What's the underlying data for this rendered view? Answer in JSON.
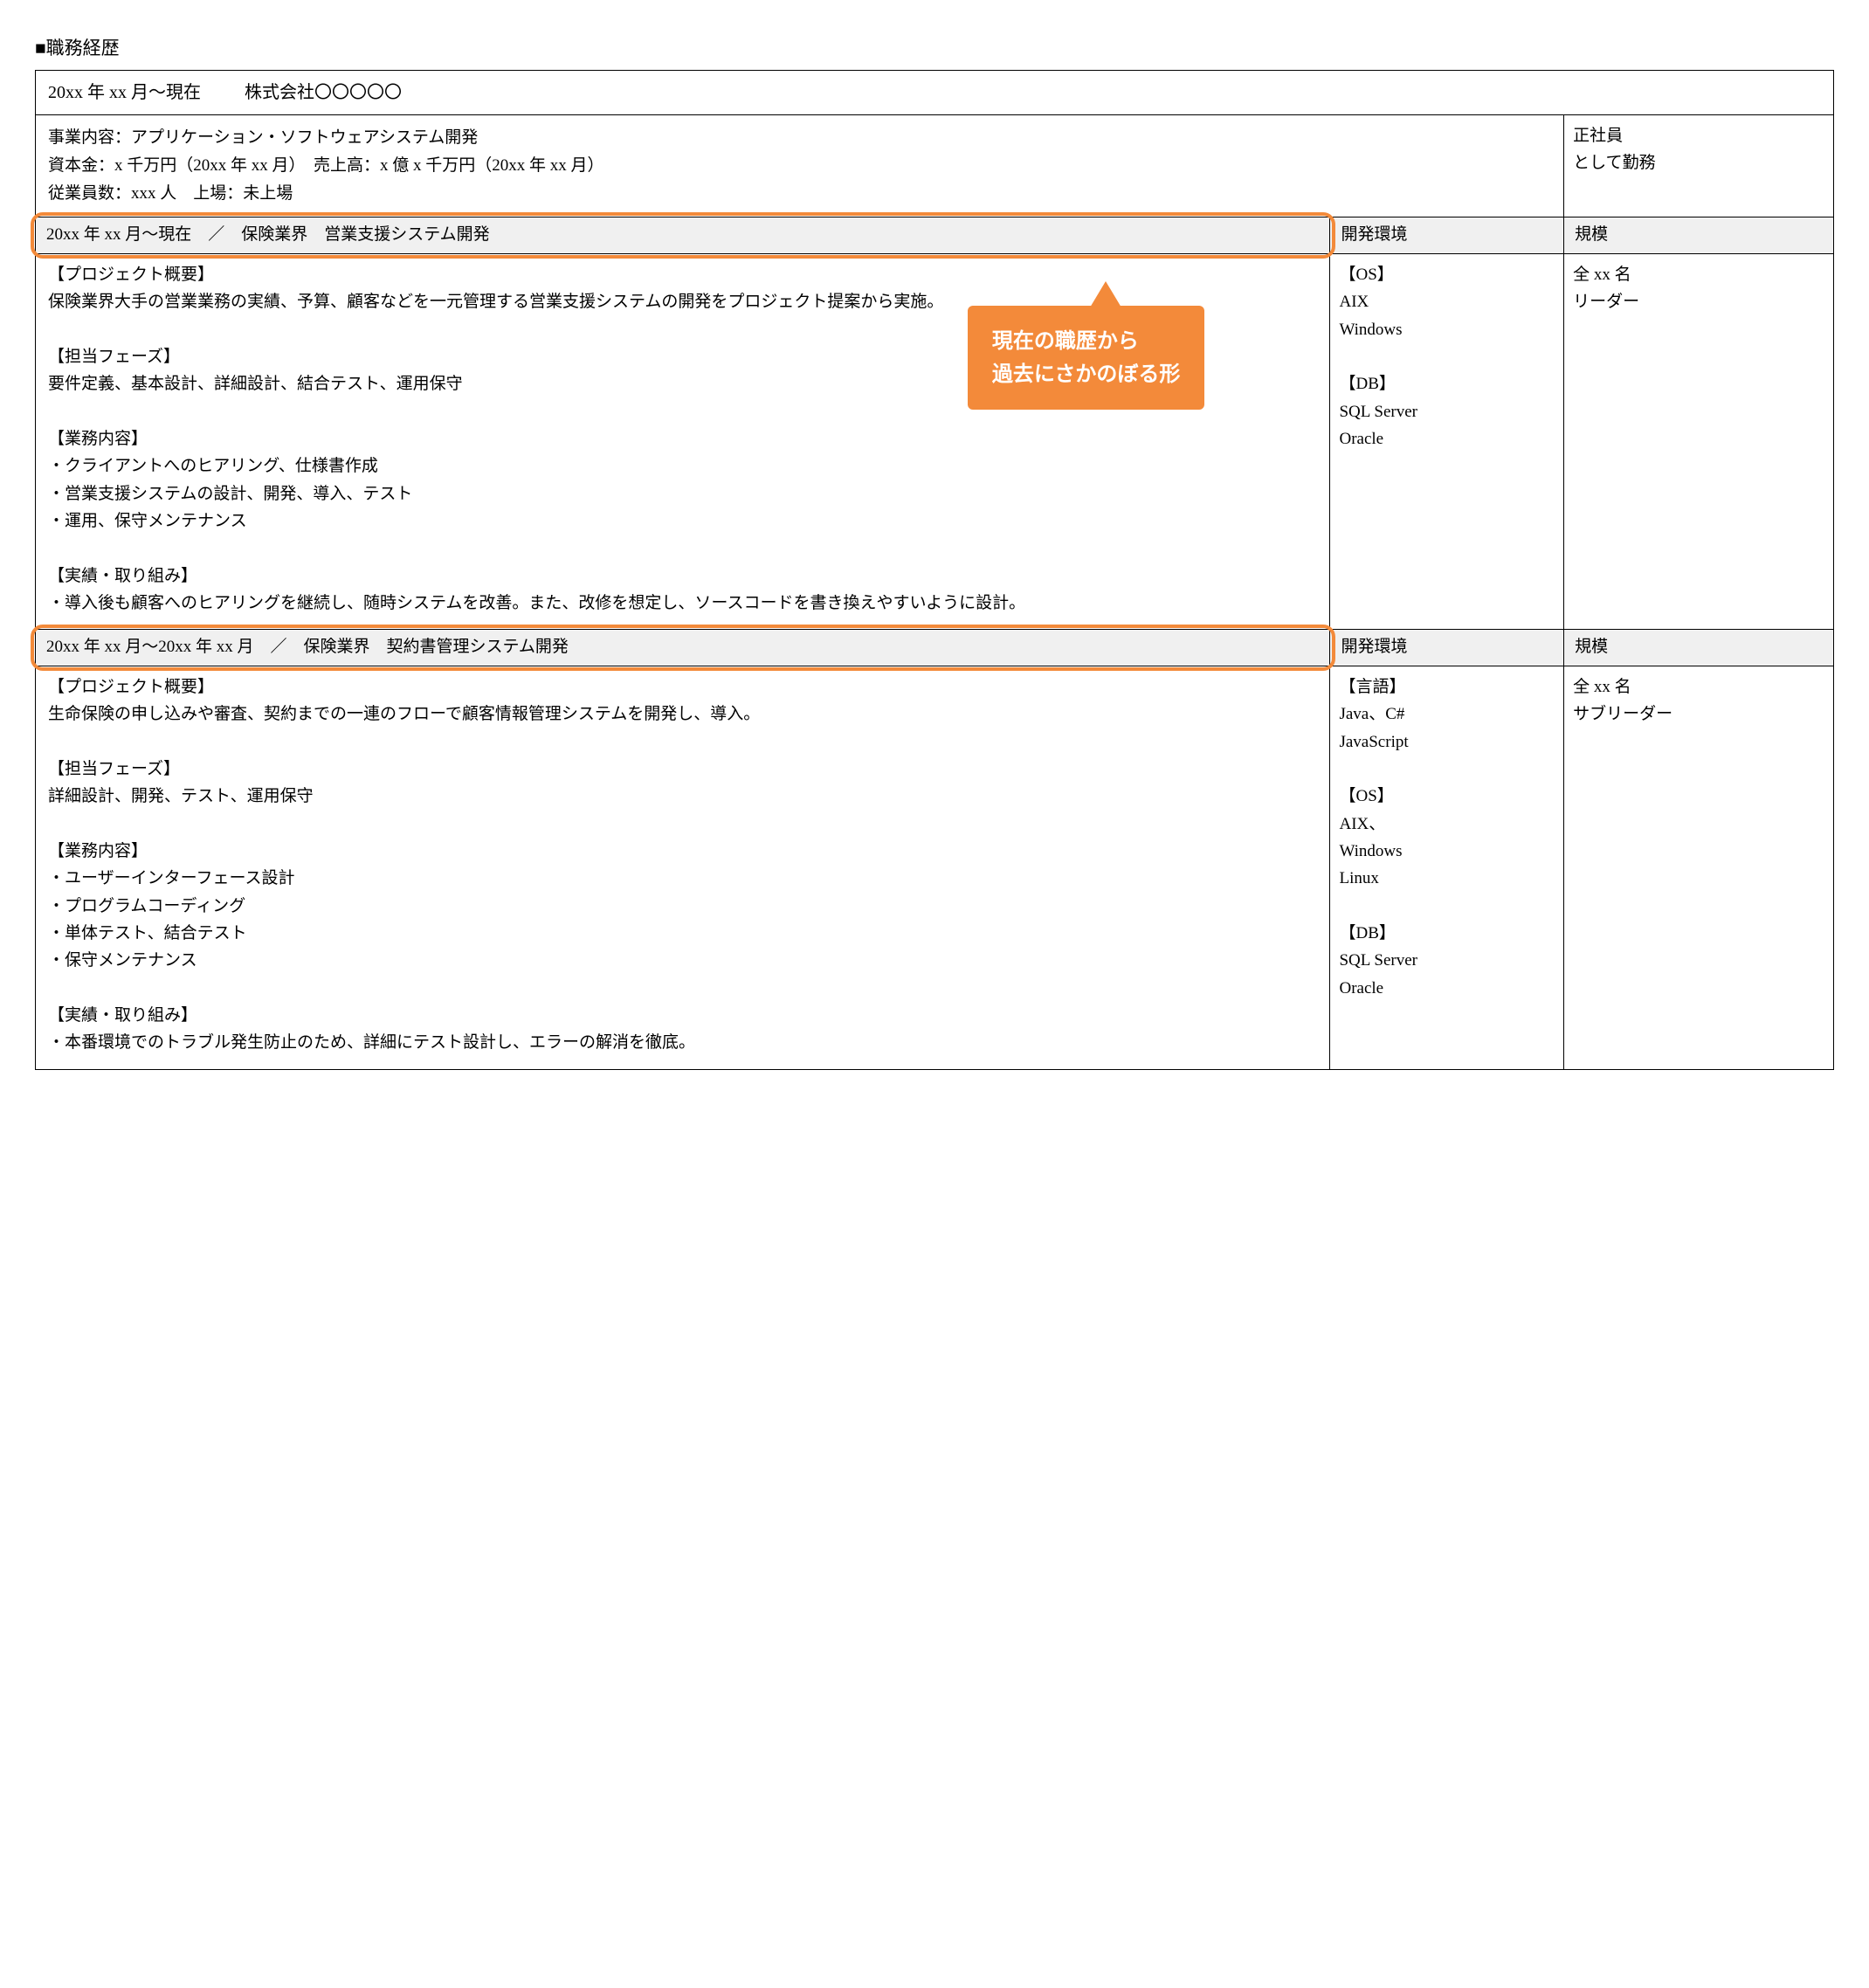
{
  "sectionTitle": "■職務経歴",
  "header": {
    "period": "20xx 年 xx 月～現在",
    "company": "株式会社〇〇〇〇〇"
  },
  "companyInfo": {
    "line1": "事業内容：アプリケーション・ソフトウェアシステム開発",
    "line2": "資本金：x 千万円（20xx 年 xx 月）　売上高：x 億 x 千万円（20xx 年 xx 月）",
    "line3": "従業員数：xxx 人　上場：未上場"
  },
  "employmentType": "正社員\nとして勤務",
  "colHeaders": {
    "env": "開発環境",
    "scale": "規模"
  },
  "project1": {
    "headerMain": "20xx 年 xx 月～現在　／　保険業界　営業支援システム開発",
    "overviewLabel": "【プロジェクト概要】",
    "overview": "保険業界大手の営業業務の実績、予算、顧客などを一元管理する営業支援システムの開発をプロジェクト提案から実施。",
    "phaseLabel": "【担当フェーズ】",
    "phase": "要件定義、基本設計、詳細設計、結合テスト、運用保守",
    "workLabel": "【業務内容】",
    "work1": "・クライアントへのヒアリング、仕様書作成",
    "work2": "・営業支援システムの設計、開発、導入、テスト",
    "work3": "・運用、保守メンテナンス",
    "achLabel": "【実績・取り組み】",
    "ach": "・導入後も顧客へのヒアリングを継続し、随時システムを改善。また、改修を想定し、ソースコードを書き換えやすいように設計。",
    "env": {
      "osLabel": "【OS】",
      "os1": "AIX",
      "os2": "Windows",
      "dbLabel": "【DB】",
      "db1": "SQL Server",
      "db2": "Oracle"
    },
    "scale": "全 xx 名\nリーダー"
  },
  "project2": {
    "headerMain": "20xx 年 xx 月～20xx 年 xx 月　／　保険業界　契約書管理システム開発",
    "overviewLabel": "【プロジェクト概要】",
    "overview": "生命保険の申し込みや審査、契約までの一連のフローで顧客情報管理システムを開発し、導入。",
    "phaseLabel": "【担当フェーズ】",
    "phase": "詳細設計、開発、テスト、運用保守",
    "workLabel": "【業務内容】",
    "work1": "・ユーザーインターフェース設計",
    "work2": "・プログラムコーディング",
    "work3": "・単体テスト、結合テスト",
    "work4": "・保守メンテナンス",
    "achLabel": "【実績・取り組み】",
    "ach": "・本番環境でのトラブル発生防止のため、詳細にテスト設計し、エラーの解消を徹底。",
    "env": {
      "langLabel": "【言語】",
      "lang1": "Java、C#",
      "lang2": "JavaScript",
      "osLabel": "【OS】",
      "os1": "AIX、",
      "os2": "Windows",
      "os3": "Linux",
      "dbLabel": "【DB】",
      "db1": "SQL Server",
      "db2": "Oracle"
    },
    "scale": "全 xx 名\nサブリーダー"
  },
  "callout": "現在の職歴から\n過去にさかのぼる形"
}
